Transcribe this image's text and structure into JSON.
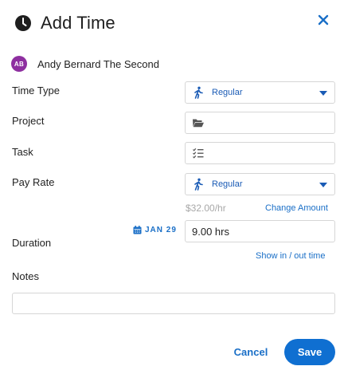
{
  "header": {
    "title": "Add Time",
    "icon": "clock-icon",
    "close_icon": "close-icon"
  },
  "user": {
    "initials": "AB",
    "name": "Andy Bernard The Second",
    "avatar_color": "#8e2fa0"
  },
  "form": {
    "time_type": {
      "label": "Time Type",
      "value": "Regular",
      "icon": "walking-person-icon"
    },
    "project": {
      "label": "Project",
      "value": "",
      "icon": "folder-open-icon"
    },
    "task": {
      "label": "Task",
      "value": "",
      "icon": "task-list-icon"
    },
    "pay_rate": {
      "label": "Pay Rate",
      "value": "Regular",
      "icon": "walking-person-icon",
      "hint": "$32.00/hr",
      "change_link": "Change Amount"
    },
    "duration": {
      "label": "Duration",
      "date": "JAN 29",
      "value": "9.00 hrs",
      "toggle_link": "Show in / out time"
    },
    "notes": {
      "label": "Notes",
      "value": ""
    }
  },
  "actions": {
    "cancel": "Cancel",
    "save": "Save"
  },
  "colors": {
    "accent": "#0f6fd1",
    "link": "#1a6fc7",
    "select_text": "#1a5bb5",
    "border": "#d6d6d6",
    "muted": "#a8a8a8"
  }
}
